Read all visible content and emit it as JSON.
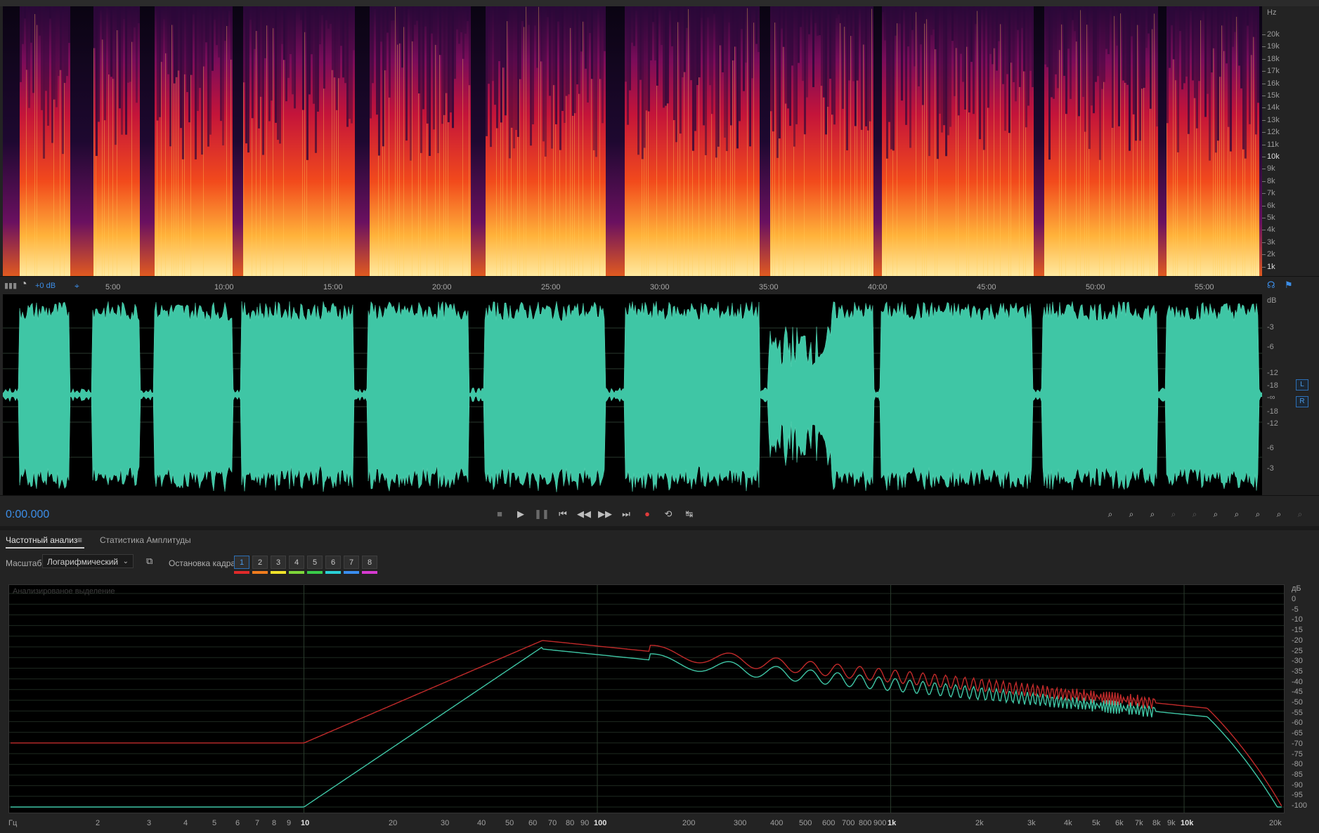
{
  "spectral_view": {
    "unit_label": "Hz",
    "freq_labels": [
      "20k",
      "19k",
      "18k",
      "17k",
      "16k",
      "15k",
      "14k",
      "13k",
      "12k",
      "11k",
      "10k",
      "9k",
      "8k",
      "7k",
      "6k",
      "5k",
      "4k",
      "3k",
      "2k",
      "1k"
    ]
  },
  "timeline": {
    "gain_label": "+0 dB",
    "time_labels": [
      "5:00",
      "10:00",
      "15:00",
      "20:00",
      "25:00",
      "30:00",
      "35:00",
      "40:00",
      "45:00",
      "50:00",
      "55:00"
    ]
  },
  "waveform": {
    "unit_label": "dB",
    "db_labels": [
      "-3",
      "-6",
      "-12",
      "-18",
      "-∞",
      "-18",
      "-12",
      "-6",
      "-3"
    ],
    "channel_left": "L",
    "channel_right": "R",
    "color": "#3fc6a5"
  },
  "transport": {
    "timecode": "0:00.000",
    "buttons": [
      "stop-icon",
      "play-icon",
      "pause-icon",
      "skip-start-icon",
      "rewind-icon",
      "fast-forward-icon",
      "skip-end-icon",
      "record-icon",
      "loop-icon",
      "skip-selection-icon"
    ],
    "record_color": "#e03b3b",
    "zoom_buttons": [
      "zoom-in-amplitude-icon",
      "zoom-out-amplitude-icon",
      "zoom-in-time-icon",
      "zoom-out-time-icon",
      "zoom-selection-icon",
      "zoom-in-left-icon",
      "zoom-in-right-icon",
      "zoom-full-icon",
      "zoom-reset-icon",
      "zoom-extra-icon"
    ]
  },
  "panel": {
    "tabs": [
      "Частотный анализ",
      "Статистика Амплитуды"
    ],
    "scale_label": "Масштаб:",
    "scale_value": "Логарифмический",
    "freeze_label": "Остановка кадра:",
    "frames": [
      "1",
      "2",
      "3",
      "4",
      "5",
      "6",
      "7",
      "8"
    ],
    "frame_colors": [
      "#e02a2a",
      "#f07c1e",
      "#f0e22a",
      "#7ed63a",
      "#3acc4a",
      "#2ad0d6",
      "#3a8ef0",
      "#d63ad0"
    ]
  },
  "spectrum": {
    "caption": "Анализированое выделение",
    "db_unit": "дБ",
    "db_labels": [
      "0",
      "-5",
      "-10",
      "-15",
      "-20",
      "-25",
      "-30",
      "-35",
      "-40",
      "-45",
      "-50",
      "-55",
      "-60",
      "-65",
      "-70",
      "-75",
      "-80",
      "-85",
      "-90",
      "-95",
      "-100"
    ],
    "freq_unit": "Гц",
    "freq_labels": [
      "2",
      "3",
      "4",
      "5",
      "6",
      "7",
      "8",
      "9",
      "10",
      "20",
      "30",
      "40",
      "50",
      "60",
      "70",
      "80",
      "90",
      "100",
      "200",
      "300",
      "400",
      "500",
      "600",
      "700",
      "800",
      "900",
      "1k",
      "2k",
      "3k",
      "4k",
      "5k",
      "6k",
      "7k",
      "8k",
      "9k",
      "10k",
      "20k"
    ],
    "series_colors": [
      "#c02a2a",
      "#3fc6a5"
    ]
  }
}
